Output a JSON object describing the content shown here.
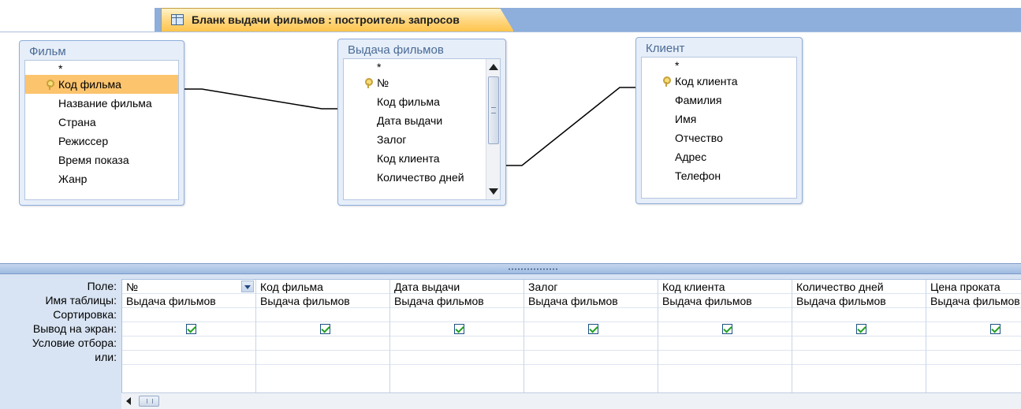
{
  "tab": {
    "title": "Бланк выдачи фильмов : построитель запросов",
    "icon": "query-design-icon"
  },
  "tables": [
    {
      "caption": "Фильм",
      "fields": [
        {
          "label": "*",
          "key": false,
          "selected": false
        },
        {
          "label": "Код фильма",
          "key": true,
          "selected": true
        },
        {
          "label": "Название фильма",
          "key": false,
          "selected": false
        },
        {
          "label": "Страна",
          "key": false,
          "selected": false
        },
        {
          "label": "Режиссер",
          "key": false,
          "selected": false
        },
        {
          "label": "Время показа",
          "key": false,
          "selected": false
        },
        {
          "label": "Жанр",
          "key": false,
          "selected": false
        }
      ]
    },
    {
      "caption": "Выдача фильмов",
      "fields": [
        {
          "label": "*",
          "key": false,
          "selected": false
        },
        {
          "label": "№",
          "key": true,
          "selected": false
        },
        {
          "label": "Код фильма",
          "key": false,
          "selected": false
        },
        {
          "label": "Дата выдачи",
          "key": false,
          "selected": false
        },
        {
          "label": "Залог",
          "key": false,
          "selected": false
        },
        {
          "label": "Код клиента",
          "key": false,
          "selected": false
        },
        {
          "label": "Количество дней",
          "key": false,
          "selected": false
        }
      ]
    },
    {
      "caption": "Клиент",
      "fields": [
        {
          "label": "*",
          "key": false,
          "selected": false
        },
        {
          "label": "Код клиента",
          "key": true,
          "selected": false
        },
        {
          "label": "Фамилия",
          "key": false,
          "selected": false
        },
        {
          "label": "Имя",
          "key": false,
          "selected": false
        },
        {
          "label": "Отчество",
          "key": false,
          "selected": false
        },
        {
          "label": "Адрес",
          "key": false,
          "selected": false
        },
        {
          "label": "Телефон",
          "key": false,
          "selected": false
        }
      ]
    }
  ],
  "grid": {
    "row_labels": [
      "Поле:",
      "Имя таблицы:",
      "Сортировка:",
      "Вывод на экран:",
      "Условие отбора:",
      "или:"
    ],
    "columns": [
      {
        "field": "№",
        "table": "Выдача фильмов",
        "sort": "",
        "show": true,
        "criteria": "",
        "or": ""
      },
      {
        "field": "Код фильма",
        "table": "Выдача фильмов",
        "sort": "",
        "show": true,
        "criteria": "",
        "or": ""
      },
      {
        "field": "Дата выдачи",
        "table": "Выдача фильмов",
        "sort": "",
        "show": true,
        "criteria": "",
        "or": ""
      },
      {
        "field": "Залог",
        "table": "Выдача фильмов",
        "sort": "",
        "show": true,
        "criteria": "",
        "or": ""
      },
      {
        "field": "Код клиента",
        "table": "Выдача фильмов",
        "sort": "",
        "show": true,
        "criteria": "",
        "or": ""
      },
      {
        "field": "Количество дней",
        "table": "Выдача фильмов",
        "sort": "",
        "show": true,
        "criteria": "",
        "or": ""
      },
      {
        "field": "Цена проката",
        "table": "Выдача фильмов",
        "sort": "",
        "show": true,
        "criteria": "",
        "or": ""
      }
    ]
  },
  "colors": {
    "tab_bar": "#8eaedc",
    "active_tab": "#ffd57c",
    "selected_field": "#fbc46d",
    "grid_bg": "#d8e4f3",
    "checkbox_check": "#21a121"
  }
}
